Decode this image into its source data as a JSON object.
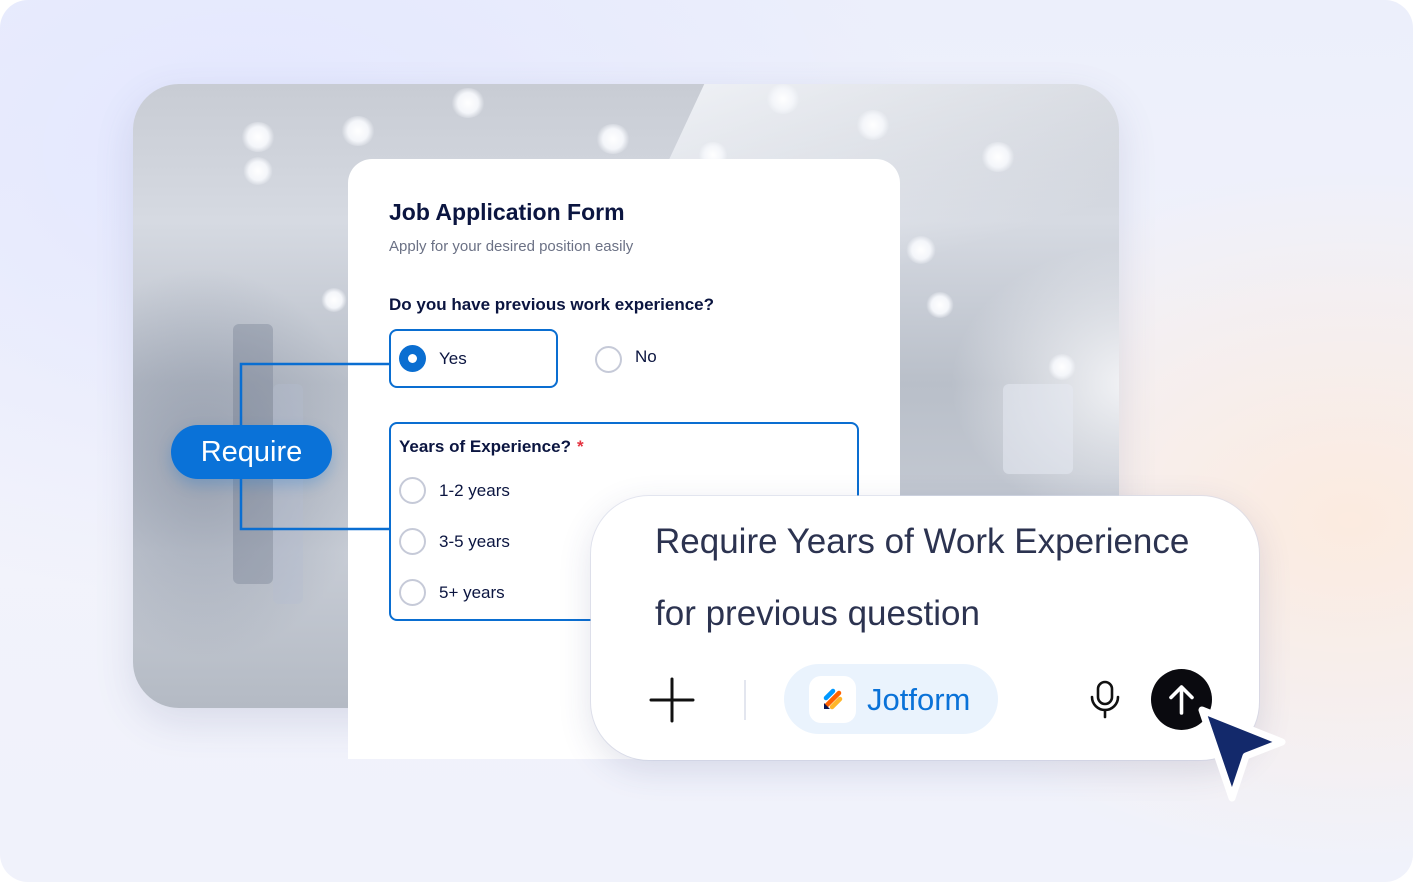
{
  "form": {
    "title": "Job Application Form",
    "subtitle": "Apply for your desired position easily",
    "question1": {
      "label": "Do you have previous work experience?",
      "options": [
        {
          "label": "Yes",
          "selected": true
        },
        {
          "label": "No",
          "selected": false
        }
      ]
    },
    "question2": {
      "label": "Years of Experience?",
      "required_marker": "*",
      "options": [
        {
          "label": "1-2 years",
          "selected": false
        },
        {
          "label": "3-5 years",
          "selected": false
        },
        {
          "label": "5+ years",
          "selected": false
        }
      ]
    }
  },
  "connector": {
    "label": "Require"
  },
  "prompt": {
    "lines": [
      "Require Years of Work Experience",
      "for previous question"
    ],
    "add_icon": "plus-icon",
    "agent_chip": {
      "label": "Jotform",
      "icon": "jotform-logo"
    },
    "mic_icon": "microphone-icon",
    "send_icon": "arrow-up-icon"
  },
  "colors": {
    "accent": "#0a72d8",
    "heading": "#0b1540",
    "required": "#e4323f",
    "send_button": "#0a0a0f",
    "cursor": "#13296b"
  }
}
